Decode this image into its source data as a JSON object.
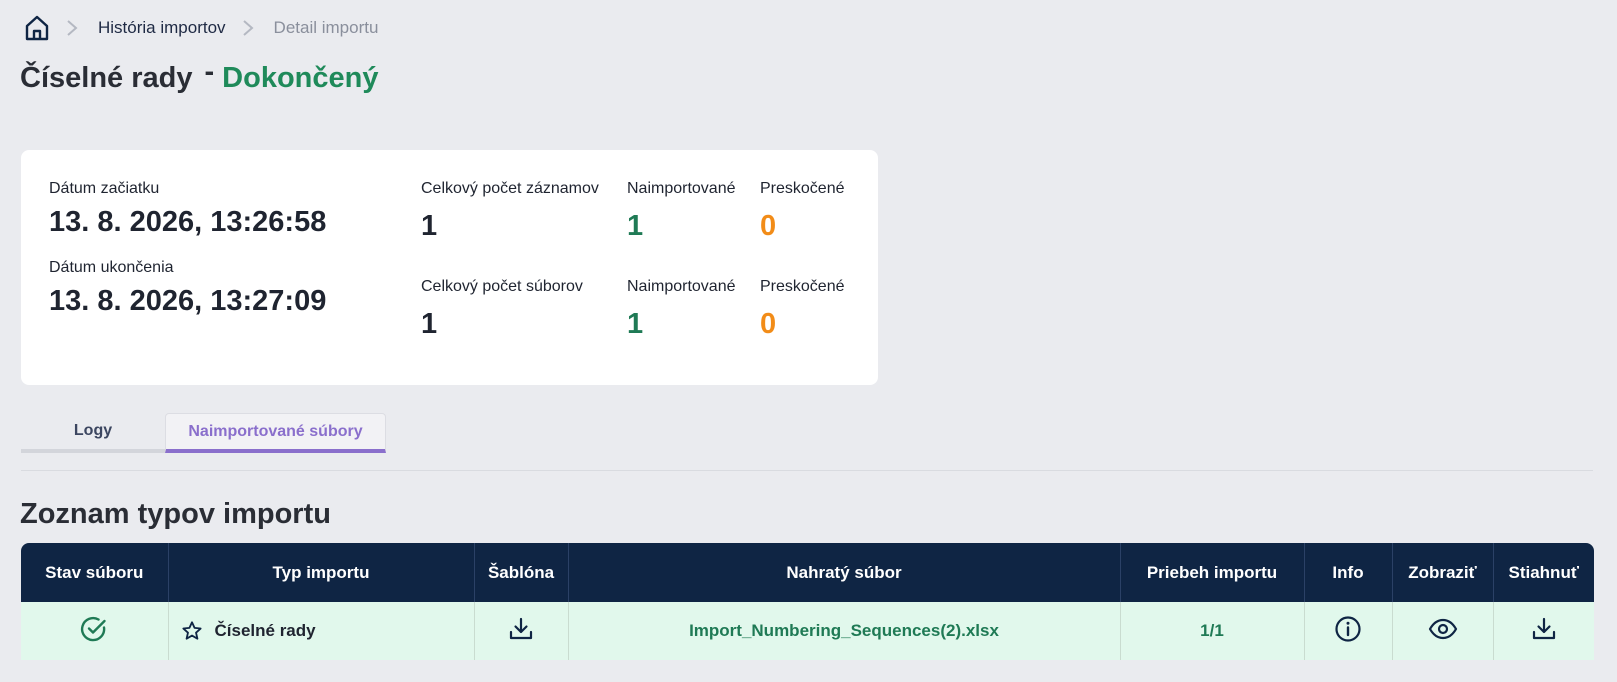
{
  "breadcrumb": {
    "home_icon": "home-icon",
    "items": [
      {
        "label": "História importov"
      },
      {
        "label": "Detail importu"
      }
    ]
  },
  "header": {
    "title": "Číselné rady",
    "separator": "-",
    "status": "Dokončený",
    "status_color": "#1f8a5a"
  },
  "summary": {
    "start_label": "Dátum začiatku",
    "start_value": "13. 8. 2026, 13:26:58",
    "end_label": "Dátum ukončenia",
    "end_value": "13. 8. 2026, 13:27:09",
    "records": {
      "total_label": "Celkový počet záznamov",
      "total_value": "1",
      "imported_label": "Naimportované",
      "imported_value": "1",
      "skipped_label": "Preskočené",
      "skipped_value": "0"
    },
    "files": {
      "total_label": "Celkový počet súborov",
      "total_value": "1",
      "imported_label": "Naimportované",
      "imported_value": "1",
      "skipped_label": "Preskočené",
      "skipped_value": "0"
    }
  },
  "tabs": [
    {
      "label": "Logy",
      "active": false
    },
    {
      "label": "Naimportované súbory",
      "active": true
    }
  ],
  "section": {
    "title": "Zoznam typov importu"
  },
  "table": {
    "columns": [
      "Stav súboru",
      "Typ importu",
      "Šablóna",
      "Nahratý súbor",
      "Priebeh importu",
      "Info",
      "Zobraziť",
      "Stiahnuť"
    ],
    "rows": [
      {
        "status_icon": "check-circle-icon",
        "type_icon": "star-icon",
        "type": "Číselné rady",
        "template_icon": "download-icon",
        "file": "Import_Numbering_Sequences(2).xlsx",
        "progress": "1/1",
        "info_icon": "info-icon",
        "view_icon": "eye-icon",
        "download_icon": "download-icon"
      }
    ]
  },
  "colors": {
    "header_bg": "#0f2544",
    "row_bg": "#e1f8ec",
    "accent_green": "#1f7a55",
    "accent_orange": "#f28c18",
    "tab_active": "#8a6fcc"
  }
}
